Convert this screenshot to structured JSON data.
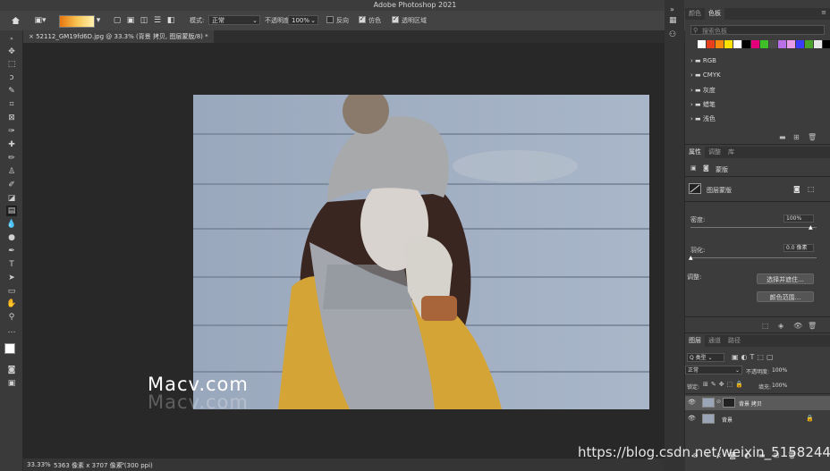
{
  "app": {
    "title": "Adobe Photoshop 2021"
  },
  "options_bar": {
    "mode_label": "模式:",
    "mode_value": "正常",
    "opacity_label": "不透明度:",
    "opacity_value": "100%",
    "reverse_label": "反向",
    "dither_label": "仿色",
    "transparency_label": "透明区域"
  },
  "document": {
    "tab_label": "52112_GM19fd6D.jpg @ 33.3% (背景 拷贝, 图层蒙版/8) *",
    "zoom": "33.33%",
    "info": "5363 像素 x 3707 像素 (300 ppi)"
  },
  "watermarks": {
    "macv": "Macv.com",
    "macv_shadow": "Macv.com",
    "csdn": "https://blog.csdn.net/weixin_51582445"
  },
  "swatches_panel": {
    "tabs": [
      "颜色",
      "色板"
    ],
    "search_placeholder": "搜索色板",
    "colors": [
      "#ffffff",
      "#e8401c",
      "#f58a0f",
      "#ffe200",
      "#ffffff",
      "#000000",
      "#e3007a",
      "#3fbf28",
      "#4c4c4c",
      "#b86fe8",
      "#e89be8",
      "#3c3cff",
      "#4aa32b",
      "#e8e8e8",
      "#000000"
    ],
    "groups": [
      "RGB",
      "CMYK",
      "灰度",
      "蜡笔",
      "浅色"
    ]
  },
  "properties_panel": {
    "tabs": [
      "属性",
      "调整",
      "库"
    ],
    "header": "蒙版",
    "mask_label": "图层蒙版",
    "density_label": "密度:",
    "density_value": "100%",
    "feather_label": "羽化:",
    "feather_value": "0.0 像素",
    "refine_label": "调整:",
    "select_mask_button": "选择并遮住...",
    "color_range_button": "颜色范围..."
  },
  "layers_panel": {
    "tabs": [
      "图层",
      "通道",
      "路径"
    ],
    "kind_label": "Q 类型",
    "blend_mode": "正常",
    "opacity_label": "不透明度:",
    "opacity_value": "100%",
    "lock_label": "锁定:",
    "fill_label": "填充:",
    "fill_value": "100%",
    "layers": [
      {
        "name": "背景 拷贝",
        "selected": true
      },
      {
        "name": "背景",
        "selected": false
      }
    ]
  }
}
